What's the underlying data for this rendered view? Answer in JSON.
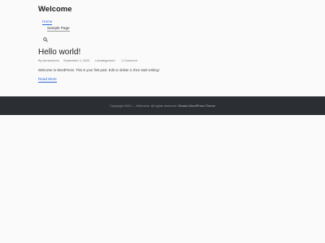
{
  "site": {
    "title": "Welcome"
  },
  "menu": {
    "items": [
      {
        "label": "Home"
      },
      {
        "label": "Sample Page"
      }
    ],
    "search_icon": "search-icon"
  },
  "post": {
    "title": "Hello world!",
    "meta": {
      "author": "By twrnwriamrs",
      "date": "September 4, 2020",
      "category": "Uncategorized",
      "comments": "1 Comment"
    },
    "excerpt": "Welcome to WordPress. This is your first post. Edit or delete it, then start writing!",
    "read_more": "Read More"
  },
  "footer": {
    "copyright": "Copyright 2020 — Welcome. All rights reserved.",
    "theme_link": "Sinatra WordPress Theme"
  },
  "colors": {
    "accent": "#2f6bd8",
    "footer_bg": "#2b2f33",
    "page_bg": "#fafafa"
  }
}
